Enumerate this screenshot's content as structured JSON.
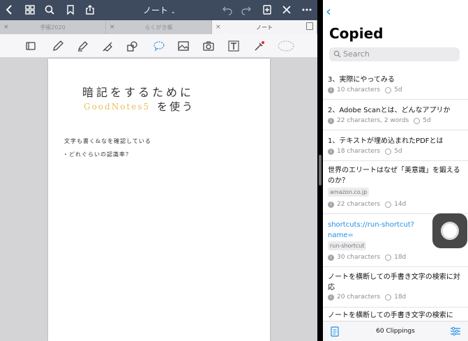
{
  "app_left": {
    "document_title": "ノート",
    "tabs": [
      {
        "label": "手帳2020",
        "active": false
      },
      {
        "label": "らくがき帳",
        "active": false
      },
      {
        "label": "ノート",
        "active": true
      }
    ],
    "toolbar_icons": [
      "thumbnail-icon",
      "pen-icon",
      "highlighter-icon",
      "eraser-icon",
      "shapes-icon",
      "lasso-icon",
      "image-icon",
      "camera-icon",
      "textbox-icon",
      "laser-pointer-icon",
      "shape-lasso-icon"
    ],
    "handwriting": {
      "line1": "暗記をするために",
      "line2_colored": "GoodNotes5",
      "line2_rest": "を使う",
      "line3": "文字も書く&なを確認している",
      "line4": "・どれぐらいの認識率？"
    },
    "accent_color": "#3e4a5e"
  },
  "app_right": {
    "back_label": "‹",
    "title": "Copied",
    "search_placeholder": "Search",
    "items": [
      {
        "text": "3、実際にやってみる",
        "chars": "10 characters",
        "age": "5d"
      },
      {
        "text": "2、Adobe Scanとは、どんなアプリか",
        "chars": "22 characters, 2 words",
        "age": "5d"
      },
      {
        "text": "1、テキストが埋め込まれたPDFとは",
        "chars": "18 characters",
        "age": "5d"
      },
      {
        "text": "世界のエリートはなぜ「美意識」を鍛えるのか？",
        "tag": "amazon.co.jp",
        "chars": "22 characters",
        "age": "14d"
      },
      {
        "text": "shortcuts://run-shortcut?name=",
        "tag": "run-shortcut",
        "chars": "30 characters",
        "age": "18d",
        "link": true
      },
      {
        "text": "ノートを横断しての手書き文字の検索に対応",
        "chars": "20 characters",
        "age": "18d"
      },
      {
        "text": "ノートを横断しての手書き文字の検索に",
        "chars": "",
        "age": ""
      }
    ],
    "footer": "60 Clippings",
    "link_color": "#1f8fe6"
  }
}
